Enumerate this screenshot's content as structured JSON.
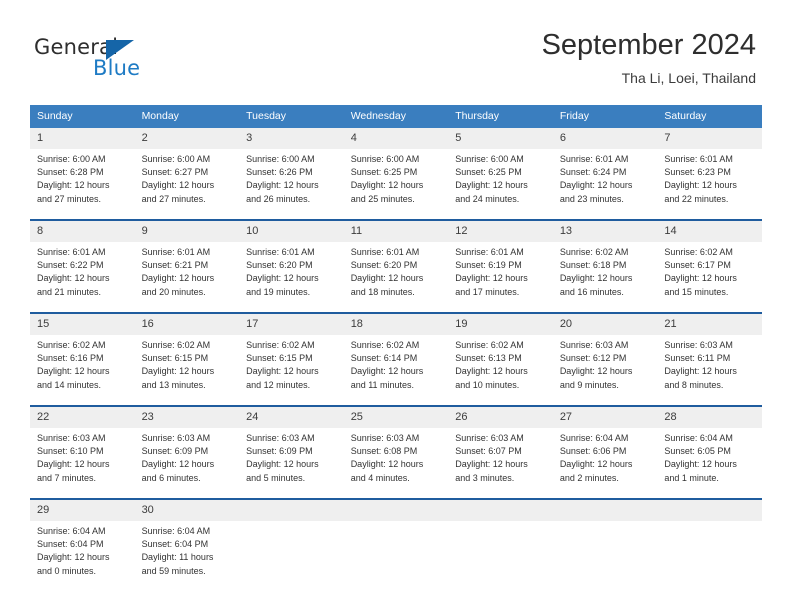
{
  "brand": {
    "name_top": "General",
    "name_bottom": "Blue",
    "triangle_icon": "blue-triangle-logo-mark",
    "color_top": "#2e2e2e",
    "color_bottom": "#1e7bc4"
  },
  "header": {
    "title": "September 2024",
    "subtitle": "Tha Li, Loei, Thailand"
  },
  "colors": {
    "header_blue": "#3a7ebf",
    "row_border_blue": "#1f5c9e",
    "daynum_band": "#efefef",
    "text": "#333333"
  },
  "weekday_headers": [
    "Sunday",
    "Monday",
    "Tuesday",
    "Wednesday",
    "Thursday",
    "Friday",
    "Saturday"
  ],
  "labels": {
    "sunrise_prefix": "Sunrise:",
    "sunset_prefix": "Sunset:",
    "daylight_prefix": "Daylight:"
  },
  "weeks": [
    [
      {
        "day": "1",
        "sunrise": "Sunrise: 6:00 AM",
        "sunset": "Sunset: 6:28 PM",
        "daylight_line1": "Daylight: 12 hours",
        "daylight_line2": "and 27 minutes."
      },
      {
        "day": "2",
        "sunrise": "Sunrise: 6:00 AM",
        "sunset": "Sunset: 6:27 PM",
        "daylight_line1": "Daylight: 12 hours",
        "daylight_line2": "and 27 minutes."
      },
      {
        "day": "3",
        "sunrise": "Sunrise: 6:00 AM",
        "sunset": "Sunset: 6:26 PM",
        "daylight_line1": "Daylight: 12 hours",
        "daylight_line2": "and 26 minutes."
      },
      {
        "day": "4",
        "sunrise": "Sunrise: 6:00 AM",
        "sunset": "Sunset: 6:25 PM",
        "daylight_line1": "Daylight: 12 hours",
        "daylight_line2": "and 25 minutes."
      },
      {
        "day": "5",
        "sunrise": "Sunrise: 6:00 AM",
        "sunset": "Sunset: 6:25 PM",
        "daylight_line1": "Daylight: 12 hours",
        "daylight_line2": "and 24 minutes."
      },
      {
        "day": "6",
        "sunrise": "Sunrise: 6:01 AM",
        "sunset": "Sunset: 6:24 PM",
        "daylight_line1": "Daylight: 12 hours",
        "daylight_line2": "and 23 minutes."
      },
      {
        "day": "7",
        "sunrise": "Sunrise: 6:01 AM",
        "sunset": "Sunset: 6:23 PM",
        "daylight_line1": "Daylight: 12 hours",
        "daylight_line2": "and 22 minutes."
      }
    ],
    [
      {
        "day": "8",
        "sunrise": "Sunrise: 6:01 AM",
        "sunset": "Sunset: 6:22 PM",
        "daylight_line1": "Daylight: 12 hours",
        "daylight_line2": "and 21 minutes."
      },
      {
        "day": "9",
        "sunrise": "Sunrise: 6:01 AM",
        "sunset": "Sunset: 6:21 PM",
        "daylight_line1": "Daylight: 12 hours",
        "daylight_line2": "and 20 minutes."
      },
      {
        "day": "10",
        "sunrise": "Sunrise: 6:01 AM",
        "sunset": "Sunset: 6:20 PM",
        "daylight_line1": "Daylight: 12 hours",
        "daylight_line2": "and 19 minutes."
      },
      {
        "day": "11",
        "sunrise": "Sunrise: 6:01 AM",
        "sunset": "Sunset: 6:20 PM",
        "daylight_line1": "Daylight: 12 hours",
        "daylight_line2": "and 18 minutes."
      },
      {
        "day": "12",
        "sunrise": "Sunrise: 6:01 AM",
        "sunset": "Sunset: 6:19 PM",
        "daylight_line1": "Daylight: 12 hours",
        "daylight_line2": "and 17 minutes."
      },
      {
        "day": "13",
        "sunrise": "Sunrise: 6:02 AM",
        "sunset": "Sunset: 6:18 PM",
        "daylight_line1": "Daylight: 12 hours",
        "daylight_line2": "and 16 minutes."
      },
      {
        "day": "14",
        "sunrise": "Sunrise: 6:02 AM",
        "sunset": "Sunset: 6:17 PM",
        "daylight_line1": "Daylight: 12 hours",
        "daylight_line2": "and 15 minutes."
      }
    ],
    [
      {
        "day": "15",
        "sunrise": "Sunrise: 6:02 AM",
        "sunset": "Sunset: 6:16 PM",
        "daylight_line1": "Daylight: 12 hours",
        "daylight_line2": "and 14 minutes."
      },
      {
        "day": "16",
        "sunrise": "Sunrise: 6:02 AM",
        "sunset": "Sunset: 6:15 PM",
        "daylight_line1": "Daylight: 12 hours",
        "daylight_line2": "and 13 minutes."
      },
      {
        "day": "17",
        "sunrise": "Sunrise: 6:02 AM",
        "sunset": "Sunset: 6:15 PM",
        "daylight_line1": "Daylight: 12 hours",
        "daylight_line2": "and 12 minutes."
      },
      {
        "day": "18",
        "sunrise": "Sunrise: 6:02 AM",
        "sunset": "Sunset: 6:14 PM",
        "daylight_line1": "Daylight: 12 hours",
        "daylight_line2": "and 11 minutes."
      },
      {
        "day": "19",
        "sunrise": "Sunrise: 6:02 AM",
        "sunset": "Sunset: 6:13 PM",
        "daylight_line1": "Daylight: 12 hours",
        "daylight_line2": "and 10 minutes."
      },
      {
        "day": "20",
        "sunrise": "Sunrise: 6:03 AM",
        "sunset": "Sunset: 6:12 PM",
        "daylight_line1": "Daylight: 12 hours",
        "daylight_line2": "and 9 minutes."
      },
      {
        "day": "21",
        "sunrise": "Sunrise: 6:03 AM",
        "sunset": "Sunset: 6:11 PM",
        "daylight_line1": "Daylight: 12 hours",
        "daylight_line2": "and 8 minutes."
      }
    ],
    [
      {
        "day": "22",
        "sunrise": "Sunrise: 6:03 AM",
        "sunset": "Sunset: 6:10 PM",
        "daylight_line1": "Daylight: 12 hours",
        "daylight_line2": "and 7 minutes."
      },
      {
        "day": "23",
        "sunrise": "Sunrise: 6:03 AM",
        "sunset": "Sunset: 6:09 PM",
        "daylight_line1": "Daylight: 12 hours",
        "daylight_line2": "and 6 minutes."
      },
      {
        "day": "24",
        "sunrise": "Sunrise: 6:03 AM",
        "sunset": "Sunset: 6:09 PM",
        "daylight_line1": "Daylight: 12 hours",
        "daylight_line2": "and 5 minutes."
      },
      {
        "day": "25",
        "sunrise": "Sunrise: 6:03 AM",
        "sunset": "Sunset: 6:08 PM",
        "daylight_line1": "Daylight: 12 hours",
        "daylight_line2": "and 4 minutes."
      },
      {
        "day": "26",
        "sunrise": "Sunrise: 6:03 AM",
        "sunset": "Sunset: 6:07 PM",
        "daylight_line1": "Daylight: 12 hours",
        "daylight_line2": "and 3 minutes."
      },
      {
        "day": "27",
        "sunrise": "Sunrise: 6:04 AM",
        "sunset": "Sunset: 6:06 PM",
        "daylight_line1": "Daylight: 12 hours",
        "daylight_line2": "and 2 minutes."
      },
      {
        "day": "28",
        "sunrise": "Sunrise: 6:04 AM",
        "sunset": "Sunset: 6:05 PM",
        "daylight_line1": "Daylight: 12 hours",
        "daylight_line2": "and 1 minute."
      }
    ],
    [
      {
        "day": "29",
        "sunrise": "Sunrise: 6:04 AM",
        "sunset": "Sunset: 6:04 PM",
        "daylight_line1": "Daylight: 12 hours",
        "daylight_line2": "and 0 minutes."
      },
      {
        "day": "30",
        "sunrise": "Sunrise: 6:04 AM",
        "sunset": "Sunset: 6:04 PM",
        "daylight_line1": "Daylight: 11 hours",
        "daylight_line2": "and 59 minutes."
      },
      {
        "day": "",
        "sunrise": "",
        "sunset": "",
        "daylight_line1": "",
        "daylight_line2": ""
      },
      {
        "day": "",
        "sunrise": "",
        "sunset": "",
        "daylight_line1": "",
        "daylight_line2": ""
      },
      {
        "day": "",
        "sunrise": "",
        "sunset": "",
        "daylight_line1": "",
        "daylight_line2": ""
      },
      {
        "day": "",
        "sunrise": "",
        "sunset": "",
        "daylight_line1": "",
        "daylight_line2": ""
      },
      {
        "day": "",
        "sunrise": "",
        "sunset": "",
        "daylight_line1": "",
        "daylight_line2": ""
      }
    ]
  ]
}
